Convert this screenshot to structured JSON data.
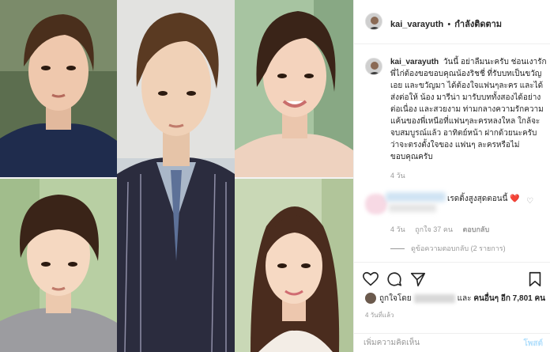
{
  "header": {
    "username": "kai_varayuth",
    "separator": "•",
    "follow_status": "กำลังติดตาม"
  },
  "caption": {
    "username": "kai_varayuth",
    "text": "วันนี้ อย่าลืมนะครับ ช่อนเงารัก พี่ไก่ต้องขอขอบคุณน้องริชชี่ ที่รับบทเป็นขวัญเอย และขวัญมา ได้ต้องใจแฟนๆละคร และได้ส่งต่อให้ น้อง มารีน่า มารับบททั้งสองได้อย่างต่อเนื่อง และสวยงาม ท่ามกลางความรักความแค้นของพี่เหนือที่แฟนๆละครหลงใหล ใกล้จะจบสมบูรณ์แล้ว อาทิตย์หน้า ฝากด้วยนะครับ ว่าจะตรงตั้งใจของ แฟนๆ ละครหรือไม่ ขอบคุณครับ",
    "time": "4 วัน"
  },
  "reply": {
    "text": "เรดติ้งสูงสุดตอนนี้ ❤️",
    "time": "4 วัน",
    "likes": "ถูกใจ 37 คน",
    "reply_label": "ตอบกลับ",
    "view_replies": "ดูข้อความตอบกลับ (2 รายการ)"
  },
  "actions": {
    "liked_by_prefix": "ถูกใจโดย",
    "and_label": "และ",
    "others_label": "คนอื่นๆ อีก 7,801 คน",
    "post_time": "4 วันที่แล้ว"
  },
  "add_comment": {
    "placeholder": "เพิ่มความคิดเห็น",
    "post_label": "โพสต์"
  },
  "colors": {
    "border": "#efefef",
    "muted_text": "#999999",
    "post_button_disabled": "#b2dffc"
  },
  "icons": [
    "heart-icon",
    "comment-bubble-icon",
    "share-arrow-icon",
    "bookmark-icon",
    "small-heart-icon"
  ]
}
